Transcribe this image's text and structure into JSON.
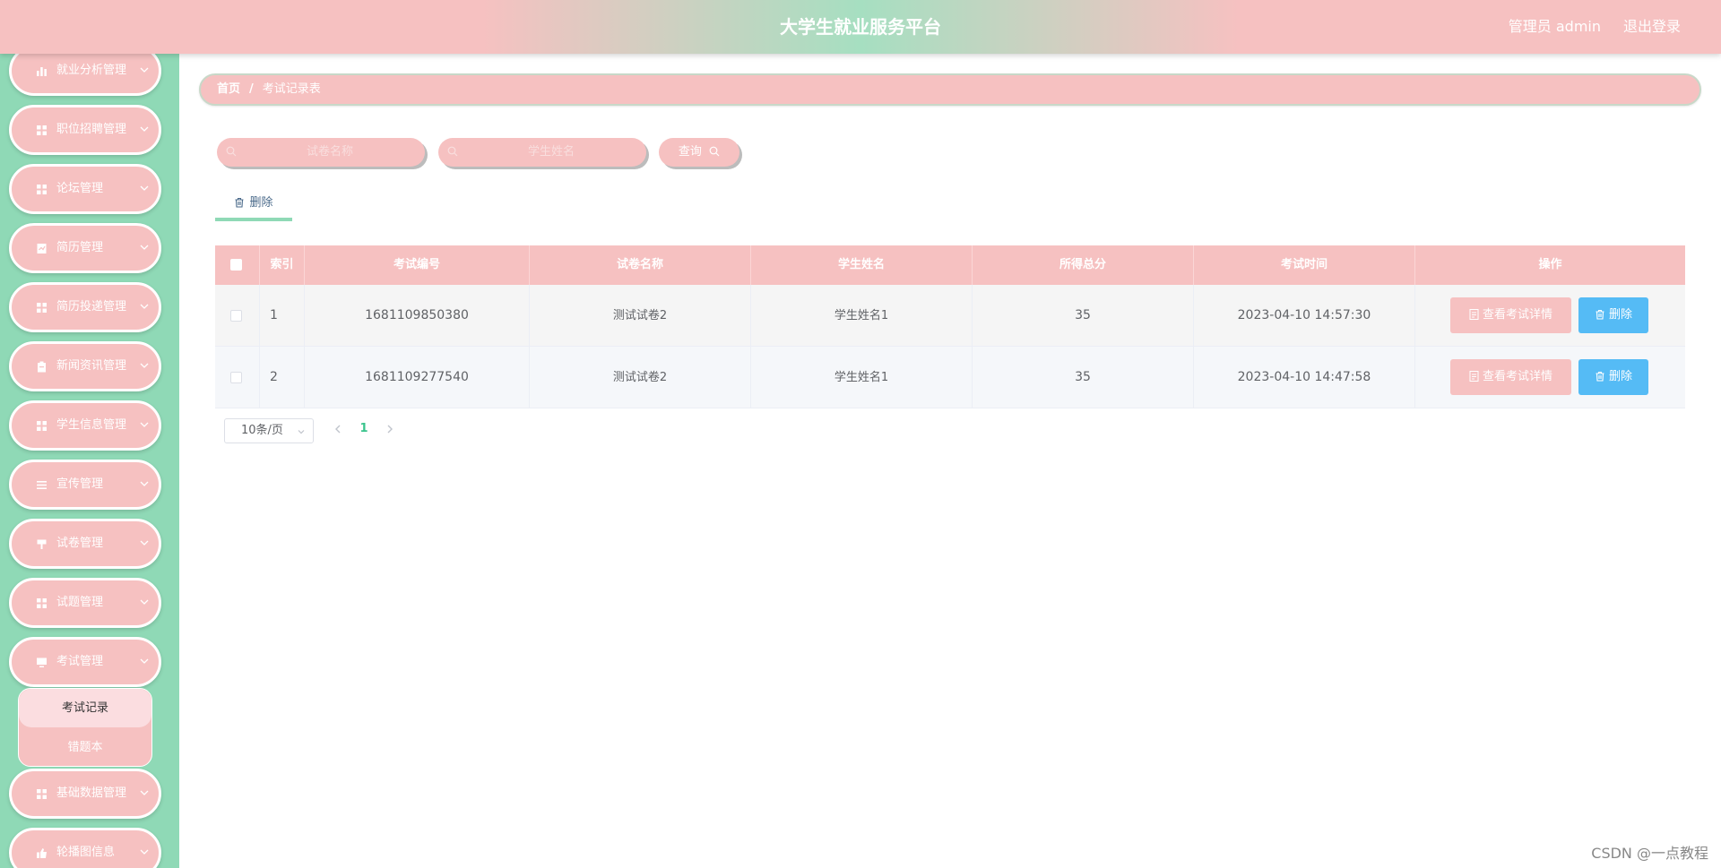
{
  "header": {
    "title": "大学生就业服务平台",
    "user": "管理员 admin",
    "logout": "退出登录"
  },
  "sidebar": {
    "items": [
      {
        "label": "就业分析管理",
        "icon": "bar-chart-icon"
      },
      {
        "label": "职位招聘管理",
        "icon": "grid-icon"
      },
      {
        "label": "论坛管理",
        "icon": "grid-icon"
      },
      {
        "label": "简历管理",
        "icon": "document-icon"
      },
      {
        "label": "简历投递管理",
        "icon": "grid-icon"
      },
      {
        "label": "新闻资讯管理",
        "icon": "clipboard-icon"
      },
      {
        "label": "学生信息管理",
        "icon": "grid-icon"
      },
      {
        "label": "宣传管理",
        "icon": "list-icon"
      },
      {
        "label": "试卷管理",
        "icon": "pen-icon"
      },
      {
        "label": "试题管理",
        "icon": "grid-icon"
      },
      {
        "label": "考试管理",
        "icon": "monitor-icon"
      },
      {
        "label": "基础数据管理",
        "icon": "grid-icon"
      },
      {
        "label": "轮播图信息",
        "icon": "thumb-icon"
      }
    ],
    "submenu": {
      "active": "考试记录",
      "other": "错题本"
    }
  },
  "breadcrumb": {
    "home": "首页",
    "separator": "/",
    "current": "考试记录表"
  },
  "search": {
    "paper_placeholder": "试卷名称",
    "student_placeholder": "学生姓名",
    "query_label": "查询"
  },
  "toolbar": {
    "delete_label": "删除"
  },
  "table": {
    "headers": [
      "索引",
      "考试编号",
      "试卷名称",
      "学生姓名",
      "所得总分",
      "考试时间",
      "操作"
    ],
    "rows": [
      {
        "index": "1",
        "exam_no": "1681109850380",
        "paper": "测试试卷2",
        "student": "学生姓名1",
        "score": "35",
        "time": "2023-04-10 14:57:30"
      },
      {
        "index": "2",
        "exam_no": "1681109277540",
        "paper": "测试试卷2",
        "student": "学生姓名1",
        "score": "35",
        "time": "2023-04-10 14:47:58"
      }
    ],
    "detail_label": "查看考试详情",
    "delete_label": "删除"
  },
  "pagination": {
    "page_size": "10条/页",
    "current_page": "1"
  },
  "watermark": "CSDN @一点教程",
  "colors": {
    "primary": "#f6c1c1",
    "sidebar": "#8fd9b6",
    "danger": "#55bbf5",
    "accent": "#3bc48d"
  }
}
